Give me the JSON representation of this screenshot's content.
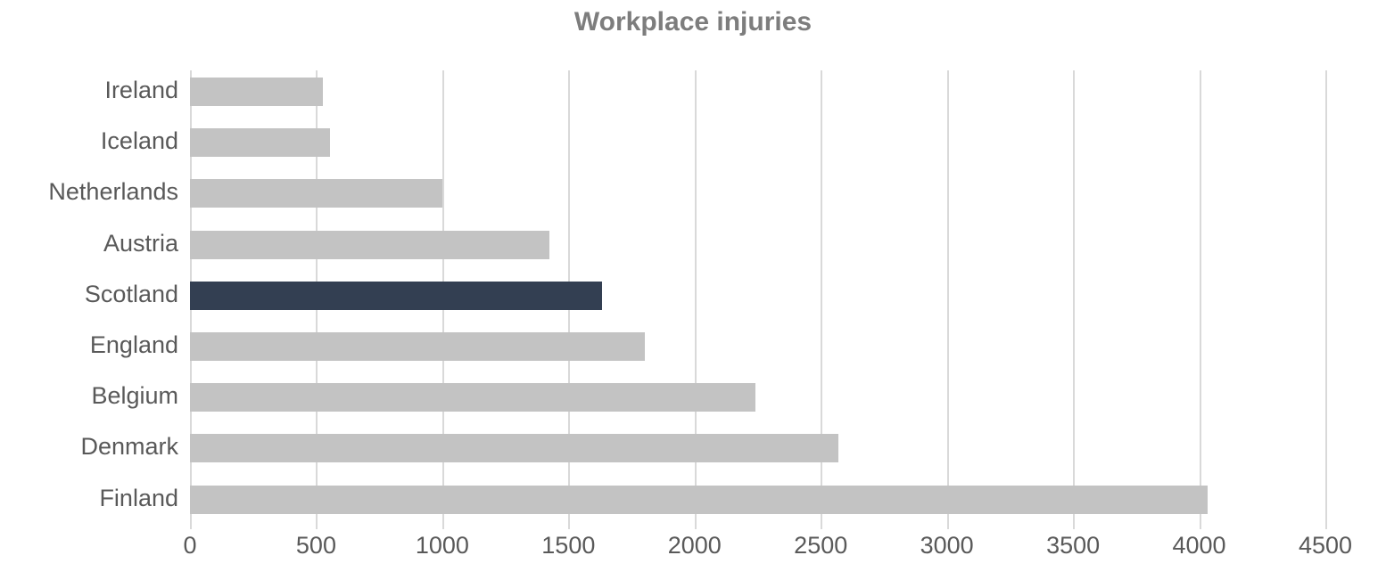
{
  "chart_data": {
    "type": "bar",
    "orientation": "horizontal",
    "title": "Workplace injuries",
    "xlabel": "",
    "ylabel": "",
    "xlim": [
      0,
      4500
    ],
    "xticks": [
      0,
      500,
      1000,
      1500,
      2000,
      2500,
      3000,
      3500,
      4000,
      4500
    ],
    "xtick_labels": [
      "0",
      "500",
      "1000",
      "1500",
      "2000",
      "2500",
      "3000",
      "3500",
      "4000",
      "4500"
    ],
    "grid": "vertical",
    "legend": "none",
    "categories": [
      "Ireland",
      "Iceland",
      "Netherlands",
      "Austria",
      "Scotland",
      "England",
      "Belgium",
      "Denmark",
      "Finland"
    ],
    "values": [
      527,
      555,
      1000,
      1424,
      1633,
      1803,
      2241,
      2570,
      4033
    ],
    "highlight_category": "Scotland",
    "colors": {
      "bar": "#c3c3c3",
      "highlight": "#333f52",
      "title": "#7d7d7d",
      "tick_text": "#595959",
      "gridline": "#d9d9d9",
      "background": "#ffffff"
    }
  }
}
